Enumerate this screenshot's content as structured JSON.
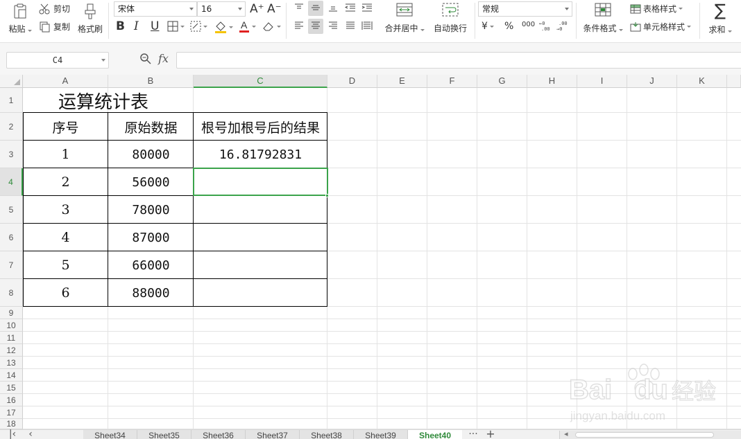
{
  "ribbon": {
    "clipboard": {
      "paste": "粘贴",
      "cut": "剪切",
      "copy": "复制",
      "format_painter": "格式刷"
    },
    "font": {
      "name": "宋体",
      "size": "16"
    },
    "alignment": {
      "merge_center": "合并居中",
      "wrap_text": "自动换行"
    },
    "number": {
      "format": "常规",
      "currency": "¥",
      "percent": "%",
      "thousands": "000"
    },
    "styles": {
      "table_style": "表格样式",
      "cell_style": "单元格样式",
      "conditional": "条件格式"
    },
    "sum": "求和"
  },
  "formula_bar": {
    "name_box": "C4",
    "fx": "fx",
    "formula": ""
  },
  "columns": [
    "A",
    "B",
    "C",
    "D",
    "E",
    "F",
    "G",
    "H",
    "I",
    "J",
    "K"
  ],
  "rows": [
    "1",
    "2",
    "3",
    "4",
    "5",
    "6",
    "7",
    "8",
    "9",
    "10",
    "11",
    "12",
    "13",
    "14",
    "15",
    "16",
    "17",
    "18"
  ],
  "sheet": {
    "title": "运算统计表",
    "headers": [
      "序号",
      "原始数据",
      "根号加根号后的结果"
    ],
    "data": [
      [
        "1",
        "80000",
        "16.81792831"
      ],
      [
        "2",
        "56000",
        ""
      ],
      [
        "3",
        "78000",
        ""
      ],
      [
        "4",
        "87000",
        ""
      ],
      [
        "5",
        "66000",
        ""
      ],
      [
        "6",
        "88000",
        ""
      ]
    ],
    "active_cell": "C4"
  },
  "tabs": [
    "Sheet34",
    "Sheet35",
    "Sheet36",
    "Sheet37",
    "Sheet38",
    "Sheet39",
    "Sheet40"
  ],
  "active_tab": "Sheet40",
  "tab_more": "···",
  "tab_add": "+",
  "watermark": {
    "brand": "Bai",
    "brand2": "du",
    "cn": "经验",
    "url": "jingyan.baidu.com"
  },
  "colors": {
    "accent_green": "#3aa34a",
    "gridline": "#e3e3e3",
    "header_bg": "#f3f3f3"
  }
}
